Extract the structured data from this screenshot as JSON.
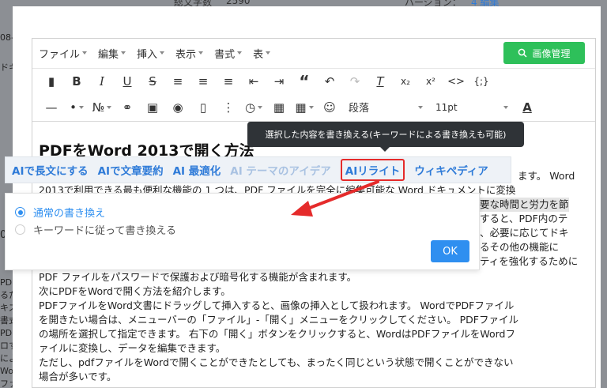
{
  "background": {
    "top_left": "総文字数",
    "top_count": "2590",
    "top_right": "バージョン：",
    "top_right_link": "4 編集",
    "left_fragments": [
      "08-",
      "ドキ",
      "",
      "0",
      "PDF",
      "るた",
      "キス",
      "書式",
      "PDF",
      "ロす",
      "によ",
      "PDF",
      "Wor",
      "ファ"
    ]
  },
  "menubar": {
    "items": [
      "ファイル",
      "編集",
      "挿入",
      "表示",
      "書式",
      "表"
    ],
    "image_button": "画像管理"
  },
  "toolbar": {
    "row1_icons": [
      "copy-format-icon",
      "bold-icon",
      "italic-icon",
      "underline-icon",
      "strikethrough-icon",
      "align-left-icon",
      "align-center-icon",
      "align-right-icon",
      "outdent-icon",
      "indent-icon",
      "blockquote-icon",
      "undo-icon",
      "redo-icon",
      "clear-format-icon",
      "subscript-icon",
      "superscript-icon",
      "code-icon",
      "code-block-icon"
    ],
    "paragraph_select": "段落",
    "font_size_select": "11pt",
    "font_color_label": "A"
  },
  "content": {
    "heading": "PDFをWord 2013で開く方法",
    "lines": [
      "ます。 Word",
      "2013で利用できる最も便利な機能の 1 つは、PDF ファイルを完全に編集可能な Word ドキュメントに変換",
      "要な時間と労力を節",
      "すると、PDF内のテ",
      "、必要に応じてドキ",
      "るその他の機能に",
      "ティを強化するために",
      "PDF ファイルをパスワードで保護および暗号化する機能が含まれます。",
      "次にPDFをWordで開く方法を紹介します。",
      "PDFファイルをWord文書にドラッグして挿入すると、画像の挿入として扱われます。 WordでPDFファイル",
      "を開きたい場合は、メニューバーの「ファイル」-「開く」メニューをクリックしてください。 PDFファイル",
      "の場所を選択して指定できます。 右下の「開く」ボタンをクリックすると、WordはPDFファイルをWordフ",
      "ァイルに変換し、データを編集できます。",
      "ただし、pdfファイルをWordで開くことができたとしても、まったく同じという状態で開くことができない",
      "場合が多いです。"
    ]
  },
  "tooltip": "選択した内容を書き換える(キーワードによる書き換えも可能)",
  "ai_bar": {
    "items": [
      "AIで長文にする",
      "AIで文章要約",
      "AI 最適化",
      "AI テーマのアイデア",
      "AIリライト",
      "ウィキペディア"
    ]
  },
  "rewrite_popup": {
    "option_normal": "通常の書き換え",
    "option_keyword": "キーワードに従って書き換える",
    "ok_label": "OK"
  },
  "colors": {
    "accent_blue": "#2f8ff0",
    "image_button_green": "#2ec05a",
    "highlight_red": "#e52b2b",
    "ai_link_blue": "#2f7bd8"
  }
}
